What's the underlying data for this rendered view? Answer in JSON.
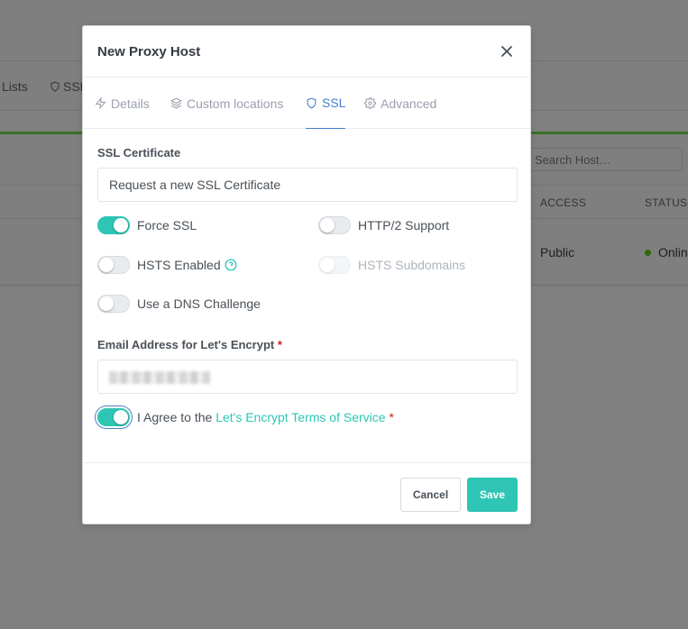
{
  "background": {
    "nav_items": [
      "Lists",
      "SSL"
    ],
    "search_placeholder": "Search Host…",
    "columns": [
      "ACCESS",
      "STATUS"
    ],
    "row": {
      "access": "Public",
      "status": "Online"
    }
  },
  "modal": {
    "title": "New Proxy Host",
    "tabs": [
      {
        "label": "Details",
        "icon": "zap-icon"
      },
      {
        "label": "Custom locations",
        "icon": "layers-icon"
      },
      {
        "label": "SSL",
        "icon": "shield-icon",
        "active": true
      },
      {
        "label": "Advanced",
        "icon": "gear-icon"
      }
    ],
    "ssl_certificate_label": "SSL Certificate",
    "ssl_certificate_value": "Request a new SSL Certificate",
    "toggles": {
      "force_ssl": {
        "label": "Force SSL",
        "on": true
      },
      "http2": {
        "label": "HTTP/2 Support",
        "on": false
      },
      "hsts": {
        "label": "HSTS Enabled",
        "on": false
      },
      "hsts_sub": {
        "label": "HSTS Subdomains",
        "on": false,
        "disabled": true
      },
      "dns": {
        "label": "Use a DNS Challenge",
        "on": false
      }
    },
    "email_label": "Email Address for Let's Encrypt",
    "required_mark": "*",
    "agree_text": "I Agree to the",
    "agree_link": "Let's Encrypt Terms of Service",
    "cancel": "Cancel",
    "save": "Save"
  },
  "colors": {
    "accent": "#2ec5b4",
    "tab_active": "#467fcf",
    "required": "#cd201f"
  }
}
